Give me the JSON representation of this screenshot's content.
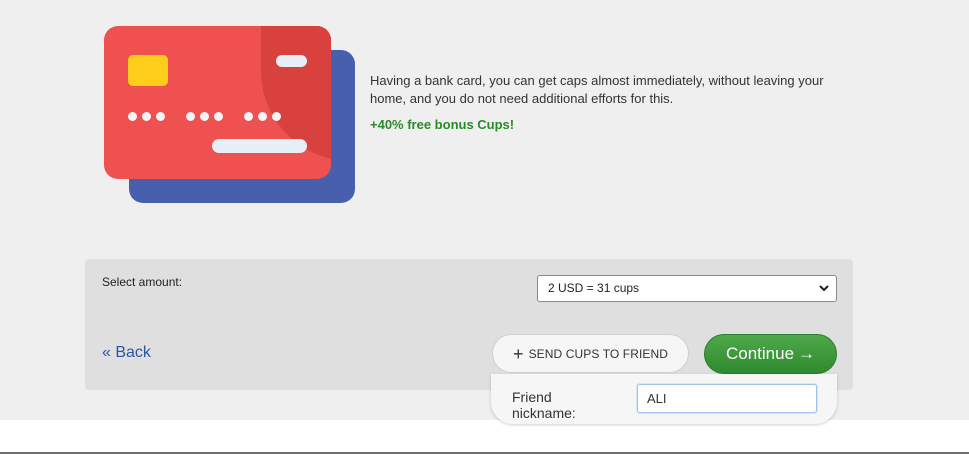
{
  "intro": {
    "description": "Having a bank card, you can get caps almost immediately, without leaving your home, and you do not need additional efforts for this.",
    "bonus": "+40% free bonus Cups!"
  },
  "amount": {
    "label": "Select amount:",
    "selected": "2 USD = 31 cups"
  },
  "actions": {
    "back_label": "« Back",
    "send_label": "SEND CUPS TO FRIEND",
    "continue_label": "Continue",
    "continue_arrow": "→"
  },
  "friend": {
    "label": "Friend nickname:",
    "value": "ALI"
  },
  "colors": {
    "card_red": "#ef5150",
    "card_blue": "#475fac",
    "chip_yellow": "#fecd1a",
    "bonus_green": "#2a8a2a",
    "continue_green": "#3c9a3a",
    "link_blue": "#2a56a5"
  },
  "icons": {
    "plus": "plus-icon",
    "select_chevron": "chevron-down-icon",
    "card": "credit-card-illustration"
  }
}
